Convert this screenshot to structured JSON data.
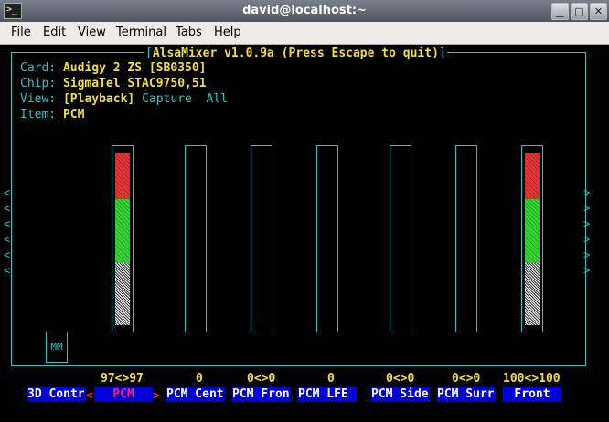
{
  "window": {
    "title": "david@localhost:~"
  },
  "menu": [
    "File",
    "Edit",
    "View",
    "Terminal",
    "Tabs",
    "Help"
  ],
  "mixer": {
    "header": "AlsaMixer v1.0.9a (Press Escape to quit)",
    "card_label": "Card:",
    "card": "Audigy 2 ZS [SB0350]",
    "chip_label": "Chip:",
    "chip": "SigmaTel STAC9750,51",
    "view_label": "View:",
    "view_selected": "[Playback]",
    "view_capture": "Capture",
    "view_all": "All",
    "item_label": "Item:",
    "item": "PCM",
    "mm_label": "MM",
    "channels": [
      {
        "name": "3D Contr",
        "value": ""
      },
      {
        "name": "PCM",
        "value": "97<>97",
        "level": 0.97
      },
      {
        "name": "PCM Cent",
        "value": "0",
        "level": 0
      },
      {
        "name": "PCM Fron",
        "value": "0<>0",
        "level": 0
      },
      {
        "name": "PCM LFE",
        "value": "0",
        "level": 0
      },
      {
        "name": "PCM Side",
        "value": "0<>0",
        "level": 0
      },
      {
        "name": "PCM Surr",
        "value": "0<>0",
        "level": 0
      },
      {
        "name": "Front",
        "value": "100<>100",
        "level": 1.0
      }
    ]
  }
}
